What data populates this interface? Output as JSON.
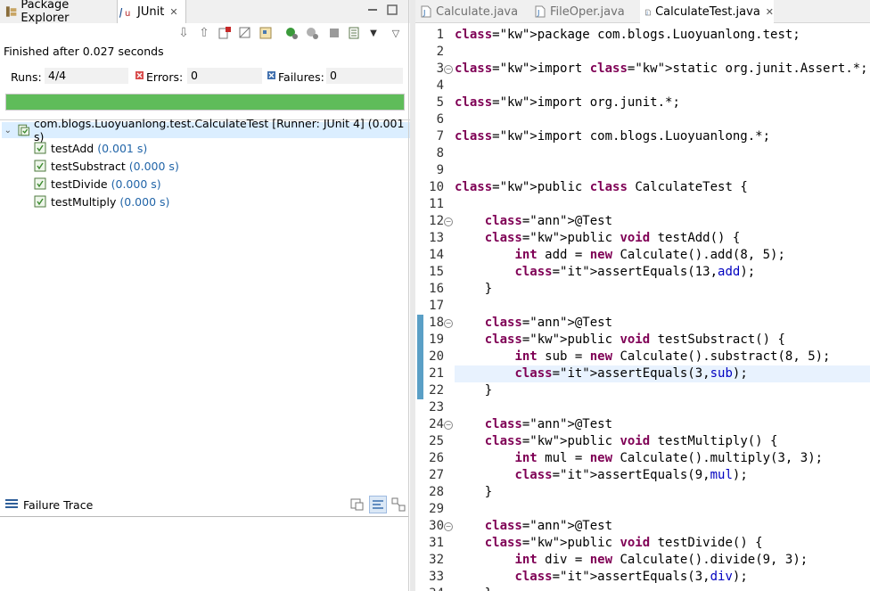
{
  "left_view": {
    "tabs": [
      {
        "label": "Package Explorer",
        "active": false
      },
      {
        "label": "JUnit",
        "active": true
      }
    ],
    "status": "Finished after 0.027 seconds",
    "counters": {
      "runs_label": "Runs:",
      "runs_value": "4/4",
      "errors_label": "Errors:",
      "errors_value": "0",
      "failures_label": "Failures:",
      "failures_value": "0"
    },
    "progress": {
      "fraction": 1.0,
      "color": "#5fbc5a"
    },
    "tree": {
      "root": "com.blogs.Luoyuanlong.test.CalculateTest [Runner: JUnit 4] (0.001 s)",
      "children": [
        {
          "name": "testAdd",
          "time": "(0.001 s)"
        },
        {
          "name": "testSubstract",
          "time": "(0.000 s)"
        },
        {
          "name": "testDivide",
          "time": "(0.000 s)"
        },
        {
          "name": "testMultiply",
          "time": "(0.000 s)"
        }
      ]
    },
    "failure_trace": {
      "title": "Failure Trace"
    }
  },
  "editor": {
    "tabs": [
      {
        "label": "Calculate.java",
        "active": false
      },
      {
        "label": "FileOper.java",
        "active": false
      },
      {
        "label": "CalculateTest.java",
        "active": true
      }
    ],
    "current_line": 21,
    "lines": [
      "package com.blogs.Luoyuanlong.test;",
      "",
      "import static org.junit.Assert.*;",
      "",
      "import org.junit.*;",
      "",
      "import com.blogs.Luoyuanlong.*;",
      "",
      "",
      "public class CalculateTest {",
      "",
      "    @Test",
      "    public void testAdd() {",
      "        int add = new Calculate().add(8, 5);",
      "        assertEquals(13,add);",
      "    }",
      "",
      "    @Test",
      "    public void testSubstract() {",
      "        int sub = new Calculate().substract(8, 5);",
      "        assertEquals(3,sub);",
      "    }",
      "",
      "    @Test",
      "    public void testMultiply() {",
      "        int mul = new Calculate().multiply(3, 3);",
      "        assertEquals(9,mul);",
      "    }",
      "",
      "    @Test",
      "    public void testDivide() {",
      "        int div = new Calculate().divide(9, 3);",
      "        assertEquals(3,div);",
      "    }"
    ],
    "fold_lines": [
      3,
      12,
      18,
      24,
      30
    ]
  }
}
